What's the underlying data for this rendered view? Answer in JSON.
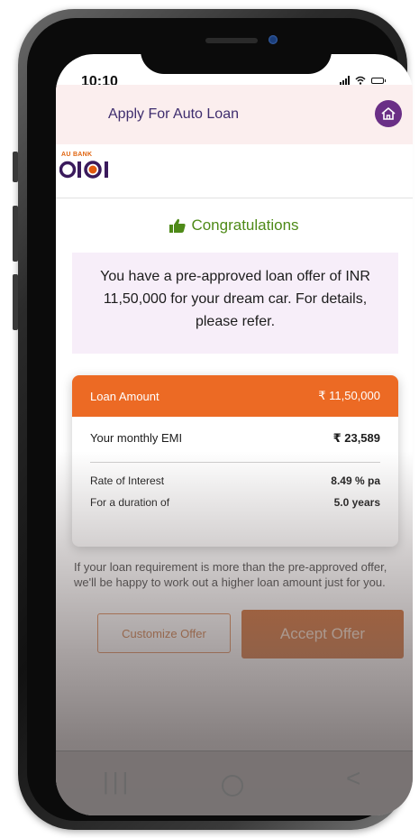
{
  "status_bar": {
    "time": "10:10"
  },
  "header": {
    "title": "Apply For Auto Loan",
    "home_icon": "home-icon"
  },
  "logo": {
    "small": "AU BANK",
    "main": "0101"
  },
  "congrats": {
    "title": "Congratulations",
    "icon": "thumbs-up-icon"
  },
  "offer_message": "You have a pre-approved loan offer of INR 11,50,000 for your dream car. For details, please refer.",
  "loan": {
    "amount_label": "Loan Amount",
    "amount_value": "₹ 11,50,000",
    "emi_label": "Your monthly EMI",
    "emi_value": "₹ 23,589",
    "roi_label": "Rate of Interest",
    "roi_value": "8.49 % pa",
    "duration_label": "For a duration of",
    "duration_value": "5.0 years"
  },
  "note": "If your loan requirement is more than the pre-approved offer, we'll be happy to work out a higher loan amount just for you.",
  "buttons": {
    "customize": "Customize Offer",
    "accept": "Accept Offer"
  },
  "nav": {
    "recent": "|||",
    "home": "",
    "back": "<"
  },
  "colors": {
    "accent": "#ec6a24",
    "brand_purple": "#6a2f86",
    "success": "#4e8a18"
  }
}
